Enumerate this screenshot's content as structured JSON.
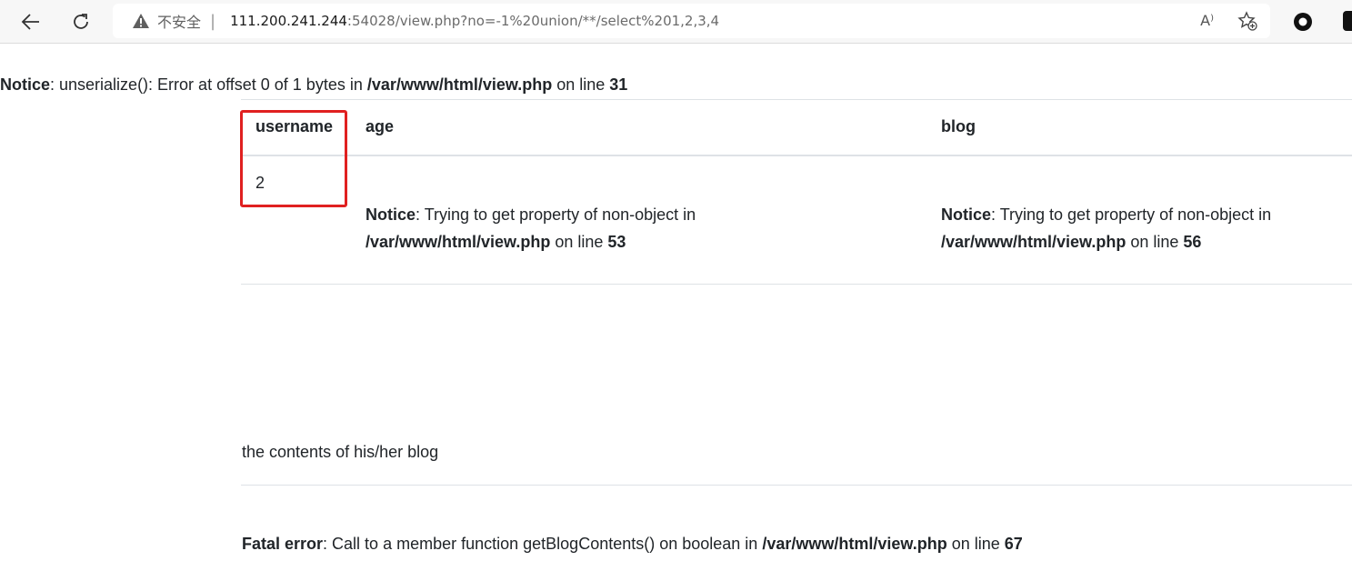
{
  "browser": {
    "insecure_label": "不安全",
    "separator": "|",
    "url_host": "111.200.241.244",
    "url_rest": ":54028/view.php?no=-1%20union/**/select%201,2,3,4",
    "read_aloud": "A⁾",
    "accent_color": "#e02020"
  },
  "notice_top": {
    "label": "Notice",
    "message": ": unserialize(): Error at offset 0 of 1 bytes in ",
    "file": "/var/www/html/view.php",
    "on_line": " on line ",
    "line": "31"
  },
  "table": {
    "headers": {
      "username": "username",
      "age": "age",
      "blog": "blog"
    },
    "row": {
      "username": "2",
      "age_notice": {
        "label": "Notice",
        "message": ": Trying to get property of non-object in ",
        "file": "/var/www/html/view.php",
        "on_line": " on line ",
        "line": "53"
      },
      "blog_notice": {
        "label": "Notice",
        "message": ": Trying to get property of non-object in ",
        "file": "/var/www/html/view.php",
        "on_line": " on line ",
        "line": "56"
      }
    }
  },
  "blog_contents": "the contents of his/her blog",
  "fatal": {
    "label": "Fatal error",
    "message": ": Call to a member function getBlogContents() on boolean in ",
    "file": "/var/www/html/view.php",
    "on_line": " on line ",
    "line": "67"
  }
}
